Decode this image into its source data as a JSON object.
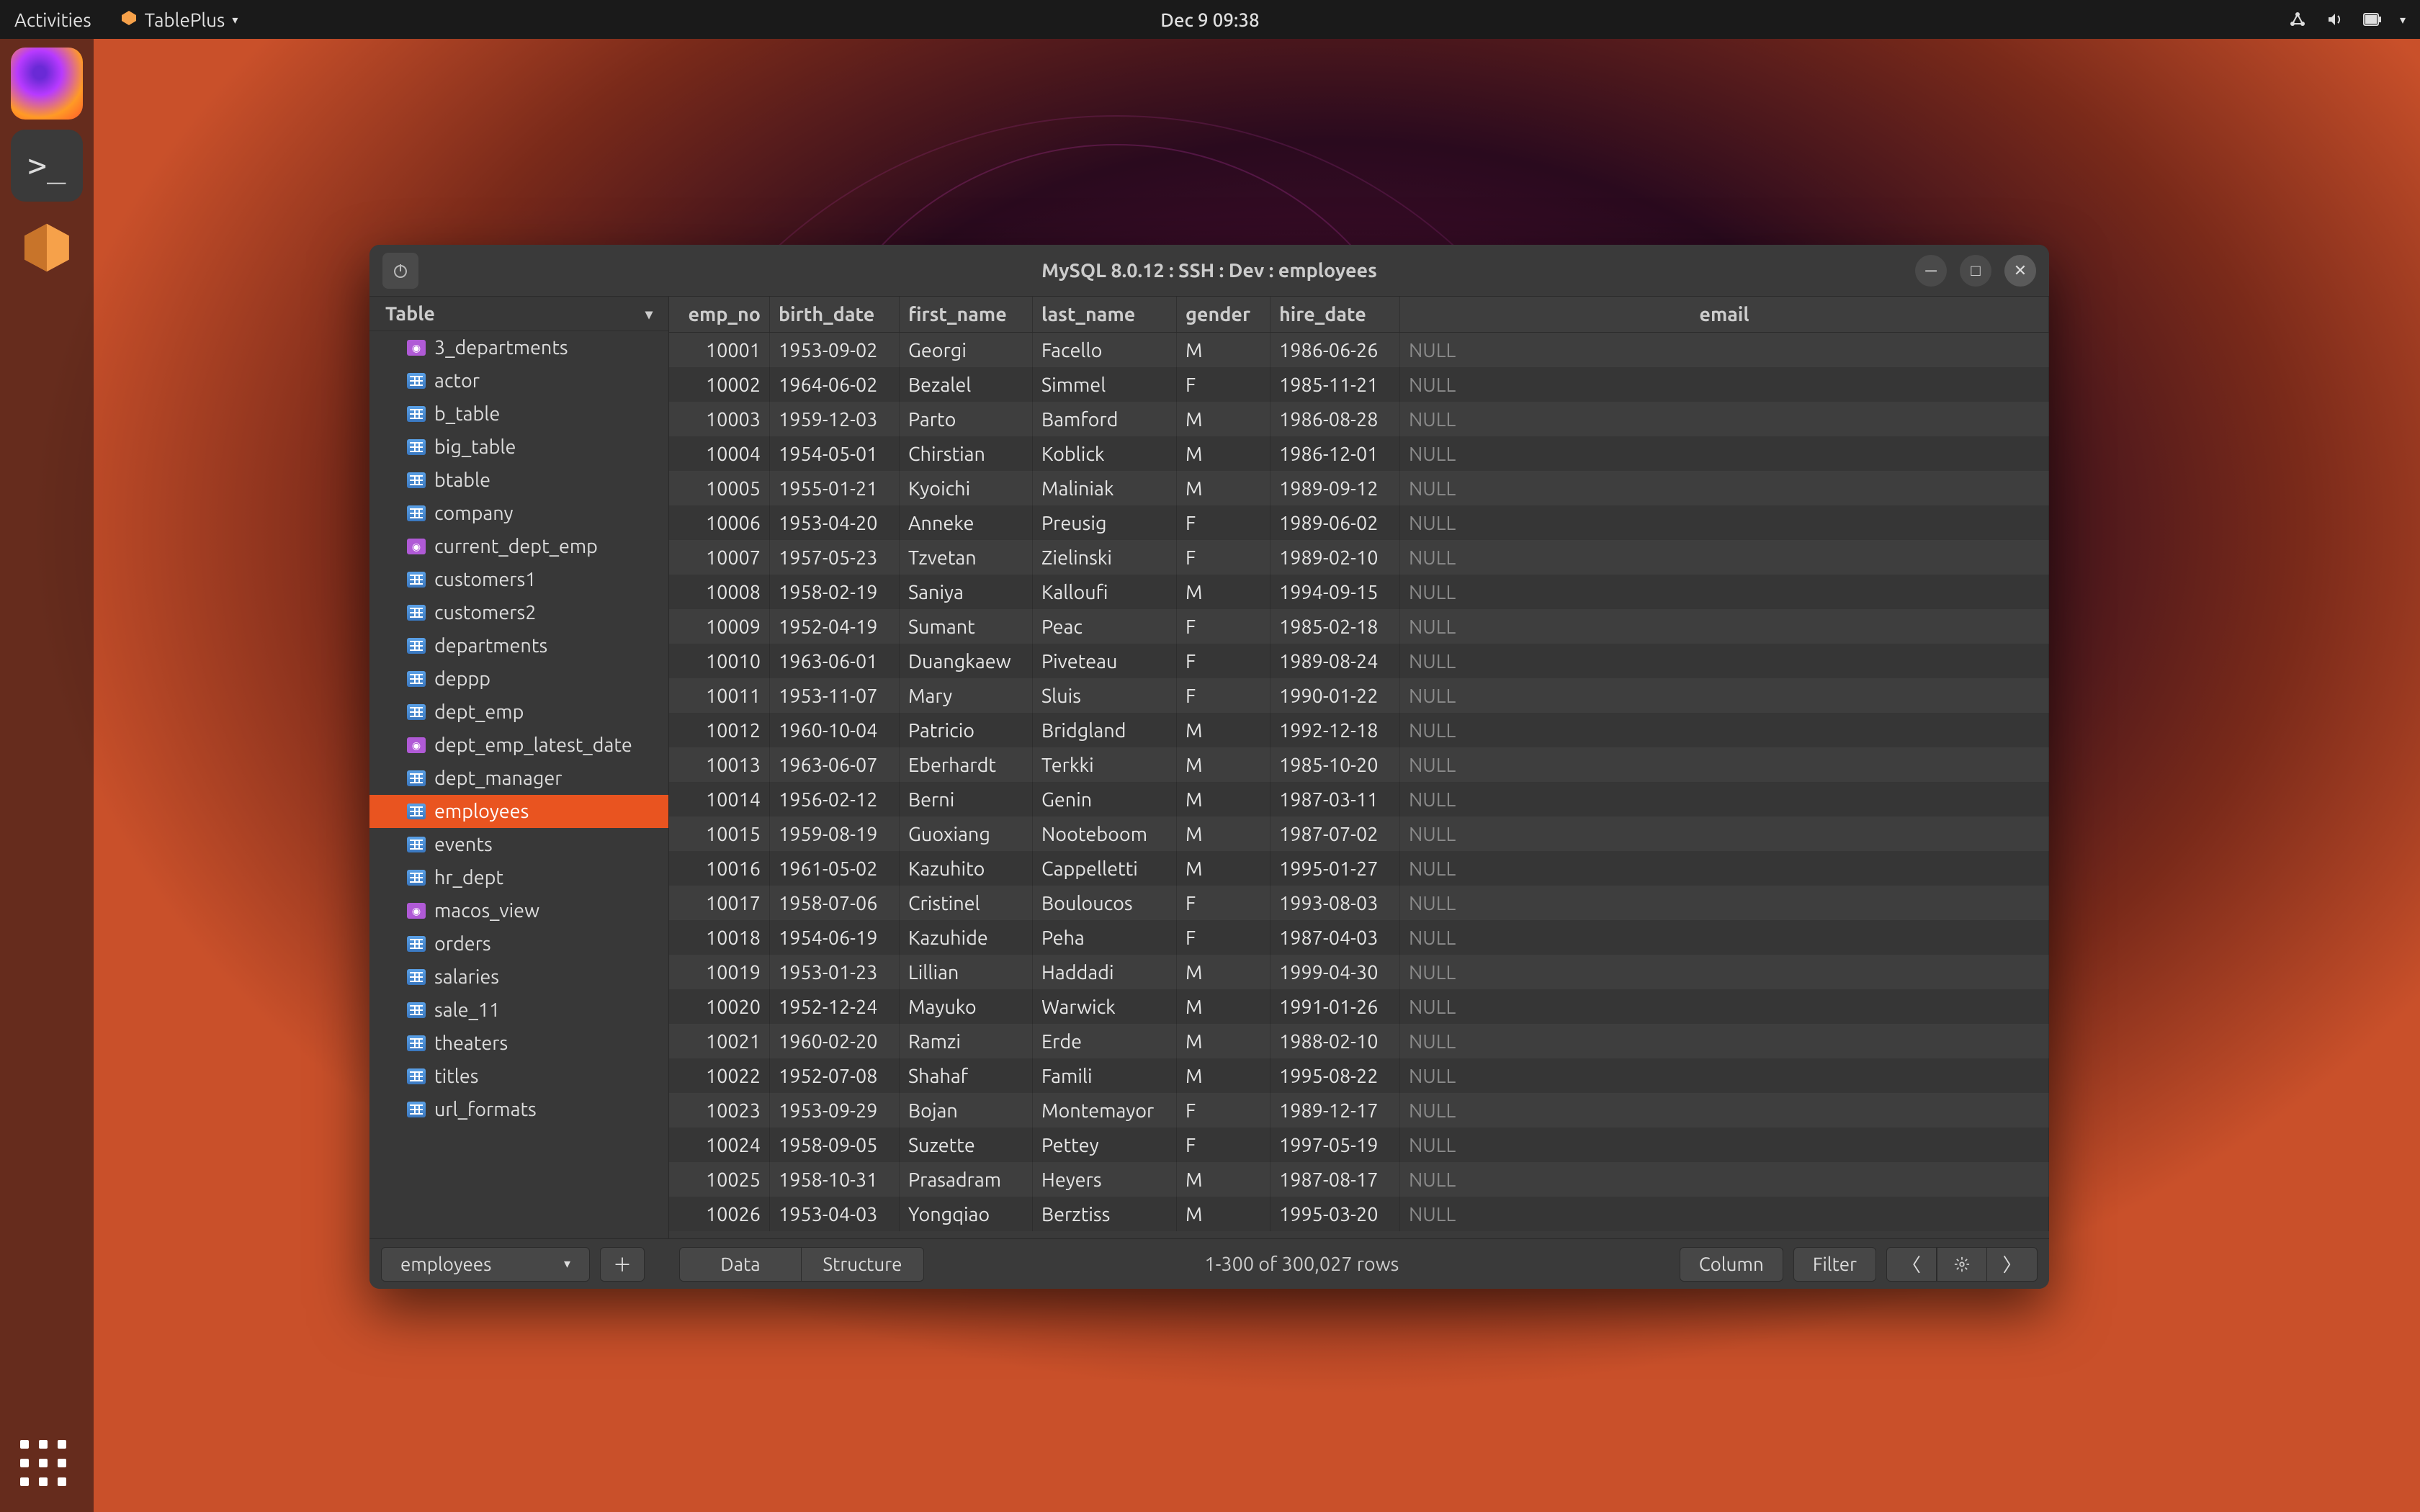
{
  "topbar": {
    "activities": "Activities",
    "app_name": "TablePlus",
    "clock": "Dec 9  09:38"
  },
  "dock": {
    "items": [
      "firefox",
      "terminal",
      "tableplus"
    ]
  },
  "window": {
    "title": "MySQL 8.0.12  :  SSH  :  Dev  :  employees"
  },
  "sidebar": {
    "header": "Table",
    "tables": [
      {
        "name": "3_departments",
        "kind": "view"
      },
      {
        "name": "actor",
        "kind": "table"
      },
      {
        "name": "b_table",
        "kind": "table"
      },
      {
        "name": "big_table",
        "kind": "table"
      },
      {
        "name": "btable",
        "kind": "table"
      },
      {
        "name": "company",
        "kind": "table"
      },
      {
        "name": "current_dept_emp",
        "kind": "view"
      },
      {
        "name": "customers1",
        "kind": "table"
      },
      {
        "name": "customers2",
        "kind": "table"
      },
      {
        "name": "departments",
        "kind": "table"
      },
      {
        "name": "deppp",
        "kind": "table"
      },
      {
        "name": "dept_emp",
        "kind": "table"
      },
      {
        "name": "dept_emp_latest_date",
        "kind": "view"
      },
      {
        "name": "dept_manager",
        "kind": "table"
      },
      {
        "name": "employees",
        "kind": "table",
        "selected": true
      },
      {
        "name": "events",
        "kind": "table"
      },
      {
        "name": "hr_dept",
        "kind": "table"
      },
      {
        "name": "macos_view",
        "kind": "view"
      },
      {
        "name": "orders",
        "kind": "table"
      },
      {
        "name": "salaries",
        "kind": "table"
      },
      {
        "name": "sale_11",
        "kind": "table"
      },
      {
        "name": "theaters",
        "kind": "table"
      },
      {
        "name": "titles",
        "kind": "table"
      },
      {
        "name": "url_formats",
        "kind": "table"
      }
    ]
  },
  "grid": {
    "columns": [
      "emp_no",
      "birth_date",
      "first_name",
      "last_name",
      "gender",
      "hire_date",
      "email"
    ],
    "rows": [
      {
        "emp_no": "10001",
        "birth_date": "1953-09-02",
        "first_name": "Georgi",
        "last_name": "Facello",
        "gender": "M",
        "hire_date": "1986-06-26",
        "email": "NULL"
      },
      {
        "emp_no": "10002",
        "birth_date": "1964-06-02",
        "first_name": "Bezalel",
        "last_name": "Simmel",
        "gender": "F",
        "hire_date": "1985-11-21",
        "email": "NULL"
      },
      {
        "emp_no": "10003",
        "birth_date": "1959-12-03",
        "first_name": "Parto",
        "last_name": "Bamford",
        "gender": "M",
        "hire_date": "1986-08-28",
        "email": "NULL"
      },
      {
        "emp_no": "10004",
        "birth_date": "1954-05-01",
        "first_name": "Chirstian",
        "last_name": "Koblick",
        "gender": "M",
        "hire_date": "1986-12-01",
        "email": "NULL"
      },
      {
        "emp_no": "10005",
        "birth_date": "1955-01-21",
        "first_name": "Kyoichi",
        "last_name": "Maliniak",
        "gender": "M",
        "hire_date": "1989-09-12",
        "email": "NULL"
      },
      {
        "emp_no": "10006",
        "birth_date": "1953-04-20",
        "first_name": "Anneke",
        "last_name": "Preusig",
        "gender": "F",
        "hire_date": "1989-06-02",
        "email": "NULL"
      },
      {
        "emp_no": "10007",
        "birth_date": "1957-05-23",
        "first_name": "Tzvetan",
        "last_name": "Zielinski",
        "gender": "F",
        "hire_date": "1989-02-10",
        "email": "NULL"
      },
      {
        "emp_no": "10008",
        "birth_date": "1958-02-19",
        "first_name": "Saniya",
        "last_name": "Kalloufi",
        "gender": "M",
        "hire_date": "1994-09-15",
        "email": "NULL"
      },
      {
        "emp_no": "10009",
        "birth_date": "1952-04-19",
        "first_name": "Sumant",
        "last_name": "Peac",
        "gender": "F",
        "hire_date": "1985-02-18",
        "email": "NULL"
      },
      {
        "emp_no": "10010",
        "birth_date": "1963-06-01",
        "first_name": "Duangkaew",
        "last_name": "Piveteau",
        "gender": "F",
        "hire_date": "1989-08-24",
        "email": "NULL"
      },
      {
        "emp_no": "10011",
        "birth_date": "1953-11-07",
        "first_name": "Mary",
        "last_name": "Sluis",
        "gender": "F",
        "hire_date": "1990-01-22",
        "email": "NULL"
      },
      {
        "emp_no": "10012",
        "birth_date": "1960-10-04",
        "first_name": "Patricio",
        "last_name": "Bridgland",
        "gender": "M",
        "hire_date": "1992-12-18",
        "email": "NULL"
      },
      {
        "emp_no": "10013",
        "birth_date": "1963-06-07",
        "first_name": "Eberhardt",
        "last_name": "Terkki",
        "gender": "M",
        "hire_date": "1985-10-20",
        "email": "NULL"
      },
      {
        "emp_no": "10014",
        "birth_date": "1956-02-12",
        "first_name": "Berni",
        "last_name": "Genin",
        "gender": "M",
        "hire_date": "1987-03-11",
        "email": "NULL"
      },
      {
        "emp_no": "10015",
        "birth_date": "1959-08-19",
        "first_name": "Guoxiang",
        "last_name": "Nooteboom",
        "gender": "M",
        "hire_date": "1987-07-02",
        "email": "NULL"
      },
      {
        "emp_no": "10016",
        "birth_date": "1961-05-02",
        "first_name": "Kazuhito",
        "last_name": "Cappelletti",
        "gender": "M",
        "hire_date": "1995-01-27",
        "email": "NULL"
      },
      {
        "emp_no": "10017",
        "birth_date": "1958-07-06",
        "first_name": "Cristinel",
        "last_name": "Bouloucos",
        "gender": "F",
        "hire_date": "1993-08-03",
        "email": "NULL"
      },
      {
        "emp_no": "10018",
        "birth_date": "1954-06-19",
        "first_name": "Kazuhide",
        "last_name": "Peha",
        "gender": "F",
        "hire_date": "1987-04-03",
        "email": "NULL"
      },
      {
        "emp_no": "10019",
        "birth_date": "1953-01-23",
        "first_name": "Lillian",
        "last_name": "Haddadi",
        "gender": "M",
        "hire_date": "1999-04-30",
        "email": "NULL"
      },
      {
        "emp_no": "10020",
        "birth_date": "1952-12-24",
        "first_name": "Mayuko",
        "last_name": "Warwick",
        "gender": "M",
        "hire_date": "1991-01-26",
        "email": "NULL"
      },
      {
        "emp_no": "10021",
        "birth_date": "1960-02-20",
        "first_name": "Ramzi",
        "last_name": "Erde",
        "gender": "M",
        "hire_date": "1988-02-10",
        "email": "NULL"
      },
      {
        "emp_no": "10022",
        "birth_date": "1952-07-08",
        "first_name": "Shahaf",
        "last_name": "Famili",
        "gender": "M",
        "hire_date": "1995-08-22",
        "email": "NULL"
      },
      {
        "emp_no": "10023",
        "birth_date": "1953-09-29",
        "first_name": "Bojan",
        "last_name": "Montemayor",
        "gender": "F",
        "hire_date": "1989-12-17",
        "email": "NULL"
      },
      {
        "emp_no": "10024",
        "birth_date": "1958-09-05",
        "first_name": "Suzette",
        "last_name": "Pettey",
        "gender": "F",
        "hire_date": "1997-05-19",
        "email": "NULL"
      },
      {
        "emp_no": "10025",
        "birth_date": "1958-10-31",
        "first_name": "Prasadram",
        "last_name": "Heyers",
        "gender": "M",
        "hire_date": "1987-08-17",
        "email": "NULL"
      },
      {
        "emp_no": "10026",
        "birth_date": "1953-04-03",
        "first_name": "Yongqiao",
        "last_name": "Berztiss",
        "gender": "M",
        "hire_date": "1995-03-20",
        "email": "NULL"
      }
    ]
  },
  "footer": {
    "table_select": "employees",
    "tab_data": "Data",
    "tab_structure": "Structure",
    "rowcount": "1-300 of 300,027 rows",
    "btn_column": "Column",
    "btn_filter": "Filter"
  }
}
